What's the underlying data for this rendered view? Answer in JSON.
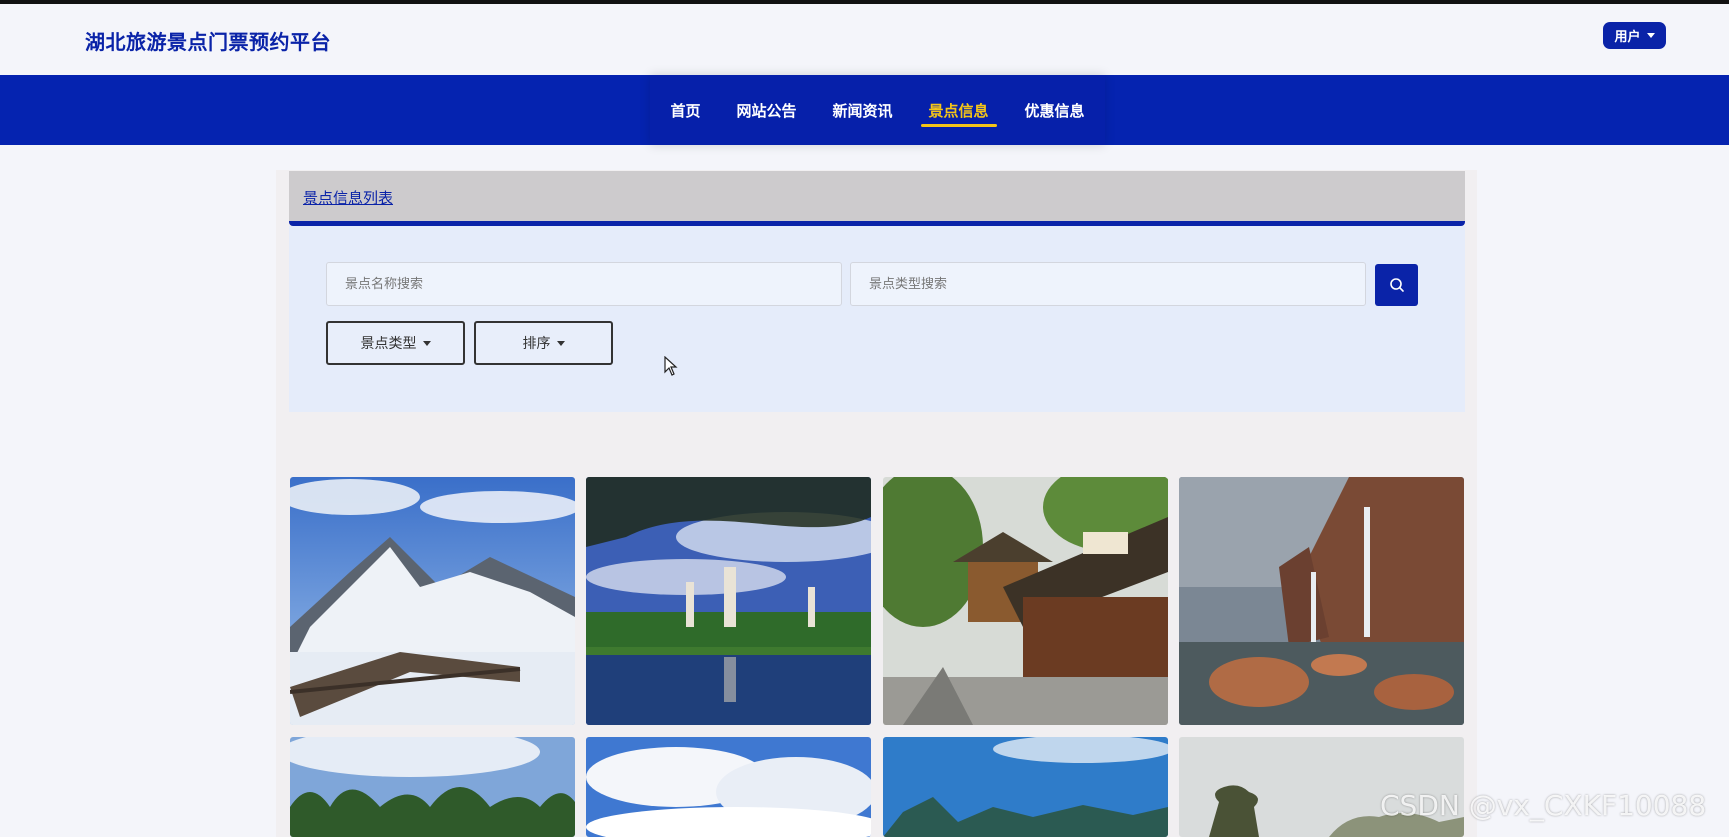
{
  "header": {
    "site_title": "湖北旅游景点门票预约平台",
    "user_menu_label": "用户"
  },
  "nav": {
    "items": [
      {
        "label": "首页",
        "active": false
      },
      {
        "label": "网站公告",
        "active": false
      },
      {
        "label": "新闻资讯",
        "active": false
      },
      {
        "label": "景点信息",
        "active": true
      },
      {
        "label": "优惠信息",
        "active": false
      }
    ],
    "active_color": "#f5c518"
  },
  "list": {
    "title": "景点信息列表"
  },
  "search": {
    "name_placeholder": "景点名称搜索",
    "name_value": "",
    "type_placeholder": "景点类型搜索",
    "type_value": "",
    "button_icon": "search-icon"
  },
  "filters": {
    "type_label": "景点类型",
    "sort_label": "排序"
  },
  "gallery": {
    "rows": 2,
    "columns": 4,
    "scenes": [
      "snowy-mountain-boardwalk",
      "pagodas-lake-reflection",
      "chinese-pavilion-garden",
      "waterfall-rocks-lake",
      "karst-hills-clouds",
      "blue-sky-clouds",
      "karst-peaks-river",
      "misty-trees-landscape"
    ]
  },
  "watermark": "CSDN @vx_CXKF10088",
  "colors": {
    "brand_blue": "#0a23a8",
    "nav_blue": "#0523b0",
    "accent_yellow": "#f5c518"
  }
}
